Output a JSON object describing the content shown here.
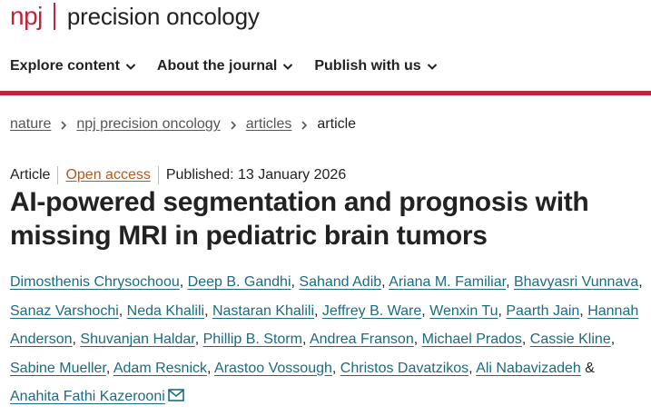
{
  "header": {
    "logo_brand": "npj",
    "logo_journal": "precision oncology"
  },
  "nav": {
    "items": [
      {
        "label": "Explore content"
      },
      {
        "label": "About the journal"
      },
      {
        "label": "Publish with us"
      }
    ]
  },
  "breadcrumb": {
    "items": [
      {
        "label": "nature"
      },
      {
        "label": "npj precision oncology"
      },
      {
        "label": "articles"
      }
    ],
    "current": "article"
  },
  "meta": {
    "type": "Article",
    "access": "Open access",
    "published": "Published: 13 January 2026"
  },
  "title": "AI-powered segmentation and prognosis with missing MRI in pediatric brain tumors",
  "authors": [
    "Dimosthenis Chrysochoou",
    "Deep B. Gandhi",
    "Sahand Adib",
    "Ariana M. Familiar",
    "Bhavyasri Vunnava",
    "Sanaz Varshochi",
    "Neda Khalili",
    "Nastaran Khalili",
    "Jeffrey B. Ware",
    "Wenxin Tu",
    "Paarth Jain",
    "Hannah Anderson",
    "Shuvanjan Haldar",
    "Phillip B. Storm",
    "Andrea Franson",
    "Michael Prados",
    "Cassie Kline",
    "Sabine Mueller",
    "Adam Resnick",
    "Arastoo Vossough",
    "Christos Davatzikos",
    "Ali Nabavizadeh",
    "Anahita Fathi Kazerooni"
  ],
  "author_separator": ", ",
  "author_last_separator": " & ",
  "colors": {
    "brand_red": "#c0243a",
    "author_link": "#1e6a82",
    "open_access": "#b4591f"
  },
  "icons": {
    "nav_chevron": "chevron-down-icon",
    "breadcrumb_separator": "chevron-right-icon",
    "corresponding_author": "mail-icon"
  }
}
